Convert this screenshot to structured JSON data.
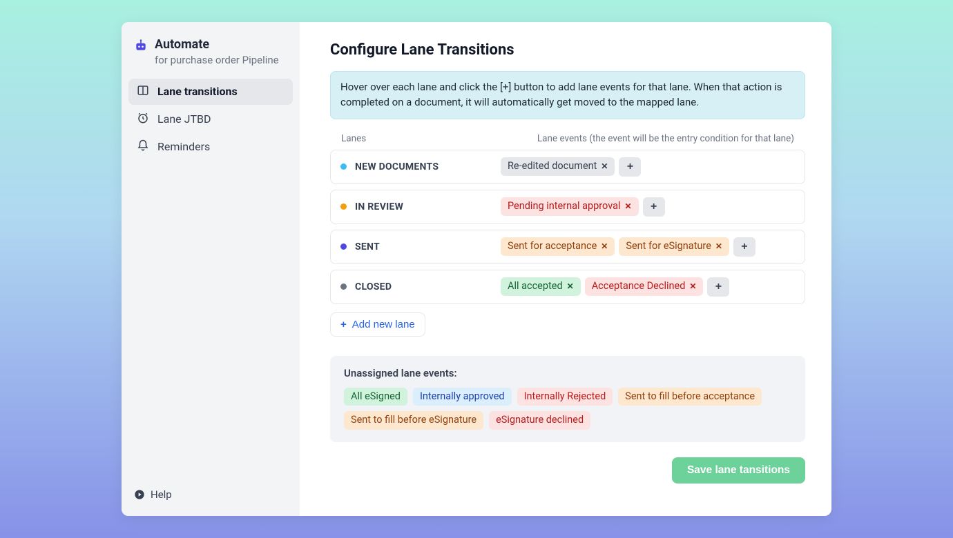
{
  "sidebar": {
    "title": "Automate",
    "subtitle": "for purchase order Pipeline",
    "nav": [
      {
        "label": "Lane transitions",
        "icon": "columns-icon",
        "active": true
      },
      {
        "label": "Lane JTBD",
        "icon": "clock-icon",
        "active": false
      },
      {
        "label": "Reminders",
        "icon": "bell-icon",
        "active": false
      }
    ],
    "help_label": "Help"
  },
  "main": {
    "title": "Configure Lane Transitions",
    "banner": "Hover over each lane and click the [+] button to add lane events for that lane. When that action is completed on a document, it will automatically get moved to the mapped lane.",
    "col_lanes": "Lanes",
    "col_events": "Lane events (the event will be the entry condition for that lane)",
    "lanes": [
      {
        "name": "NEW DOCUMENTS",
        "dot_color": "#38bdf8",
        "events": [
          {
            "label": "Re-edited document",
            "style": "gray"
          }
        ]
      },
      {
        "name": "IN REVIEW",
        "dot_color": "#f59e0b",
        "events": [
          {
            "label": "Pending internal approval",
            "style": "red"
          }
        ]
      },
      {
        "name": "SENT",
        "dot_color": "#4f46e5",
        "events": [
          {
            "label": "Sent for acceptance",
            "style": "orange"
          },
          {
            "label": "Sent for eSignature",
            "style": "orange"
          }
        ]
      },
      {
        "name": "CLOSED",
        "dot_color": "#6b7280",
        "events": [
          {
            "label": "All accepted",
            "style": "green"
          },
          {
            "label": "Acceptance Declined",
            "style": "red"
          }
        ]
      }
    ],
    "add_lane_label": "Add new lane",
    "unassigned_title": "Unassigned lane events:",
    "unassigned": [
      {
        "label": "All eSigned",
        "style": "green"
      },
      {
        "label": "Internally approved",
        "style": "blue"
      },
      {
        "label": "Internally Rejected",
        "style": "red"
      },
      {
        "label": "Sent to fill before acceptance",
        "style": "orange"
      },
      {
        "label": "Sent to fill before eSignature",
        "style": "orange"
      },
      {
        "label": "eSignature declined",
        "style": "red"
      }
    ],
    "save_label": "Save lane tansitions"
  }
}
